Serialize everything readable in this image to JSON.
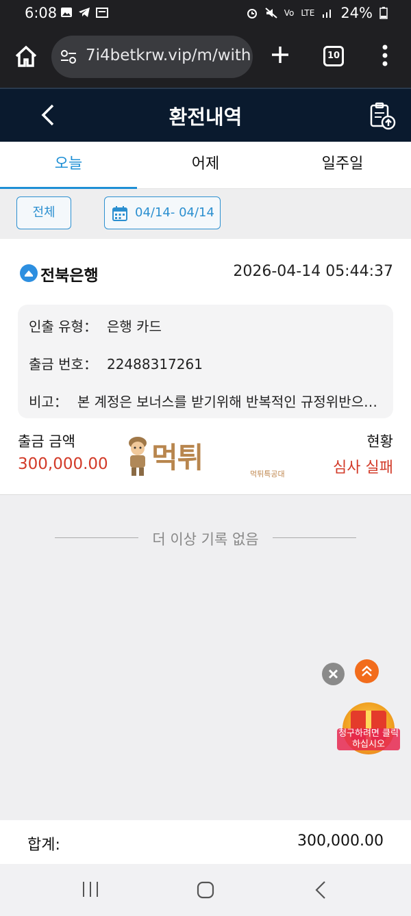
{
  "status_bar": {
    "time": "6:08",
    "battery": "24%",
    "network": "LTE"
  },
  "browser": {
    "url": "7i4betkrw.vip/m/with",
    "tab_count": "10"
  },
  "header": {
    "title": "환전내역"
  },
  "tabs": [
    {
      "label": "오늘",
      "active": true
    },
    {
      "label": "어제",
      "active": false
    },
    {
      "label": "일주일",
      "active": false
    }
  ],
  "filters": {
    "all_label": "전체",
    "date_range": "04/14- 04/14"
  },
  "record": {
    "bank": "전북은행",
    "datetime": "2026-04-14 05:44:37",
    "type_label": "인출 유형：",
    "type_value": "은행 카드",
    "no_label": "출금 번호：",
    "no_value": "22488317261",
    "note_label": "비고：",
    "note_value": "본 계정은 보너스를 받기위해 반복적인 규정위반으로 인하여 출금이 제한됩니다",
    "amount_label": "출금 금액",
    "amount_value": "300,000.00",
    "status_label": "현황",
    "status_value": "심사 실패"
  },
  "watermark": {
    "main": "먹튀",
    "sub": "먹튀특공대"
  },
  "empty_message": "더 이상 기록 없음",
  "promo": {
    "text": "청구하려면 클릭하십시오"
  },
  "footer": {
    "total_label": "합계:",
    "total_value": "300,000.00"
  },
  "colors": {
    "accent": "#1e8fd5",
    "header_bg": "#0a1a2e",
    "danger": "#d23a28"
  }
}
